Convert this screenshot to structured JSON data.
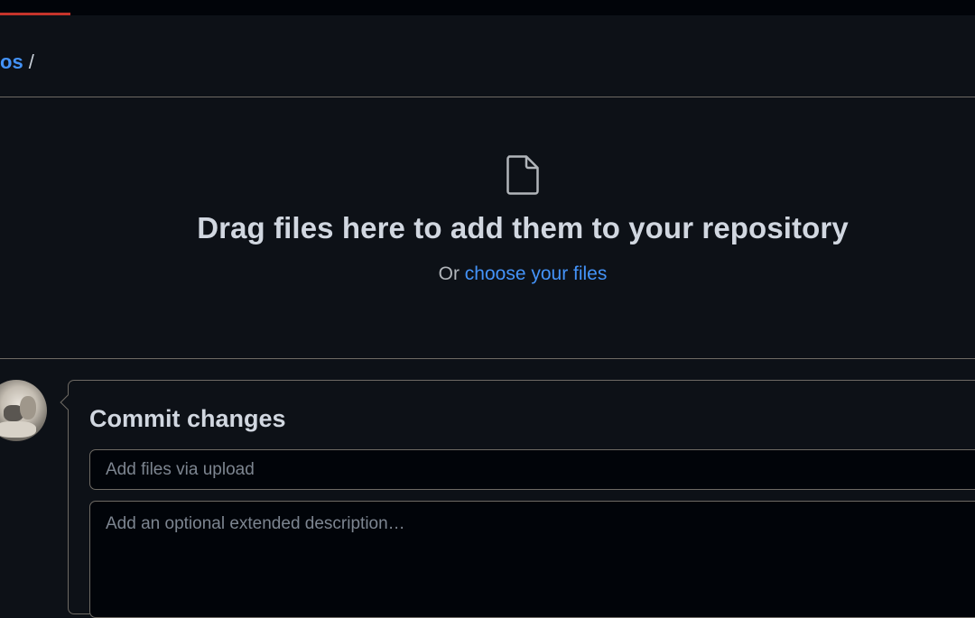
{
  "breadcrumb": {
    "repo_fragment": "os",
    "separator": "/"
  },
  "dropzone": {
    "icon": "file-icon",
    "title": "Drag files here to add them to your repository",
    "or_text": "Or ",
    "choose_link": "choose your files"
  },
  "commit": {
    "title": "Commit changes",
    "summary_placeholder": "Add files via upload",
    "summary_value": "",
    "description_placeholder": "Add an optional extended description…",
    "description_value": ""
  },
  "colors": {
    "background": "#0d1117",
    "link": "#4493f8",
    "border": "#6e6a64",
    "progress": "#c6342b"
  }
}
